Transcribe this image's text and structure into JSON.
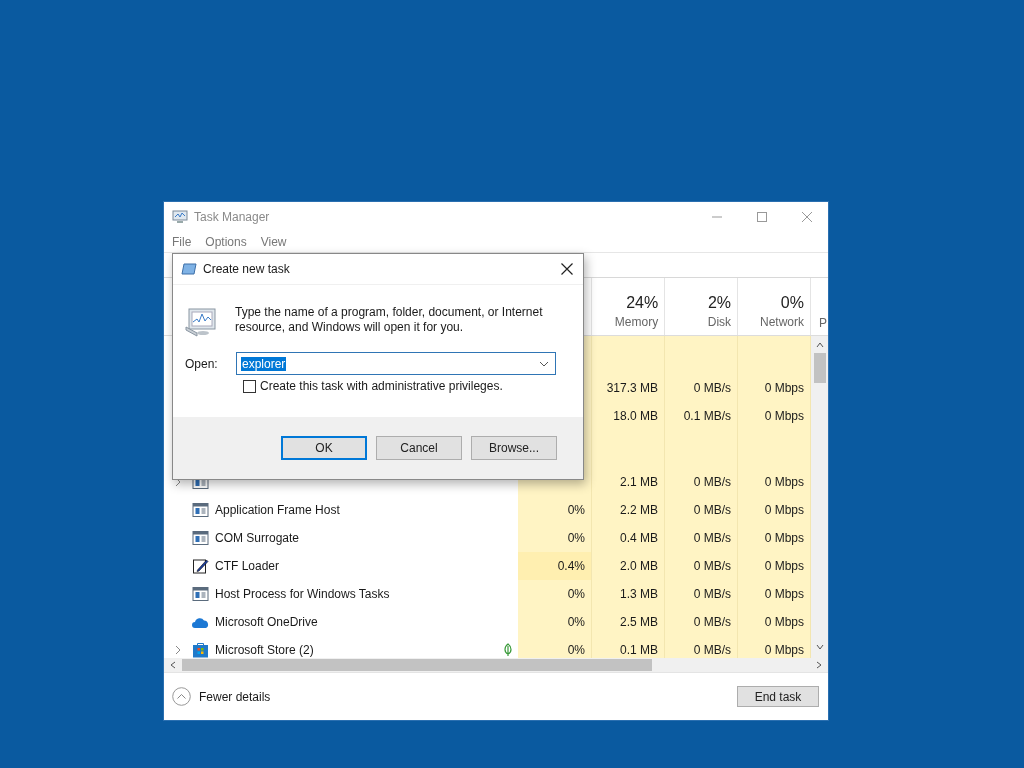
{
  "task_manager": {
    "title": "Task Manager",
    "menu": [
      "File",
      "Options",
      "View"
    ],
    "columns": [
      {
        "percent": "24%",
        "label": "Memory"
      },
      {
        "percent": "2%",
        "label": "Disk"
      },
      {
        "percent": "0%",
        "label": "Network"
      },
      {
        "label": "P"
      }
    ],
    "rows": [
      {
        "kind": "group"
      },
      {
        "kind": "hidden",
        "memory": "317.3 MB",
        "disk": "0 MB/s",
        "network": "0 Mbps"
      },
      {
        "kind": "hidden",
        "memory": "18.0 MB",
        "disk": "0.1 MB/s",
        "network": "0 Mbps"
      },
      {
        "kind": "group"
      },
      {
        "kind": "window",
        "expandable": true,
        "eco": false,
        "memory": "2.1 MB",
        "disk": "0 MB/s",
        "network": "0 Mbps"
      },
      {
        "kind": "window",
        "name": "Application Frame Host",
        "expandable": false,
        "eco": false,
        "cpu": "0%",
        "memory": "2.2 MB",
        "disk": "0 MB/s",
        "network": "0 Mbps"
      },
      {
        "kind": "window",
        "name": "COM Surrogate",
        "expandable": false,
        "eco": false,
        "cpu": "0%",
        "memory": "0.4 MB",
        "disk": "0 MB/s",
        "network": "0 Mbps"
      },
      {
        "kind": "pen",
        "name": "CTF Loader",
        "expandable": false,
        "eco": false,
        "cpu": "0.4%",
        "memory": "2.0 MB",
        "disk": "0 MB/s",
        "network": "0 Mbps"
      },
      {
        "kind": "window",
        "name": "Host Process for Windows Tasks",
        "expandable": false,
        "eco": false,
        "cpu": "0%",
        "memory": "1.3 MB",
        "disk": "0 MB/s",
        "network": "0 Mbps"
      },
      {
        "kind": "cloud",
        "name": "Microsoft OneDrive",
        "expandable": false,
        "eco": false,
        "cpu": "0%",
        "memory": "2.5 MB",
        "disk": "0 MB/s",
        "network": "0 Mbps"
      },
      {
        "kind": "store",
        "name": "Microsoft Store (2)",
        "expandable": true,
        "eco": true,
        "cpu": "0%",
        "memory": "0.1 MB",
        "disk": "0 MB/s",
        "network": "0 Mbps"
      }
    ],
    "fewer_details": "Fewer details",
    "end_task": "End task"
  },
  "dialog": {
    "title": "Create new task",
    "message": "Type the name of a program, folder, document, or Internet resource, and Windows will open it for you.",
    "open_label": "Open:",
    "open_value": "explorer",
    "checkbox": {
      "label": "Create this task with administrative privileges.",
      "checked": false
    },
    "buttons": [
      {
        "label": "OK",
        "default": true
      },
      {
        "label": "Cancel",
        "default": false
      },
      {
        "label": "Browse...",
        "default": false
      }
    ]
  }
}
